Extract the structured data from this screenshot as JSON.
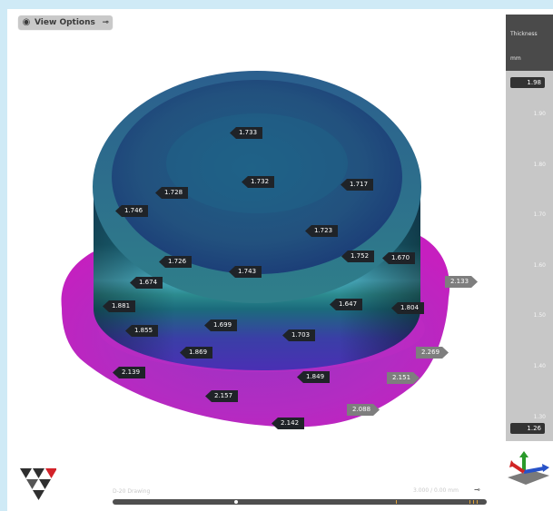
{
  "toolbar": {
    "view_options_label": "View Options"
  },
  "legend": {
    "title": "Thickness",
    "unit": "mm",
    "max_value": "1.98",
    "min_value": "1.26",
    "ticks": [
      "1.90",
      "1.80",
      "1.70",
      "1.60",
      "1.50",
      "1.40",
      "1.30"
    ],
    "colors": [
      "#e21ad7",
      "#9d2ad5",
      "#5a2fd3",
      "#3a6ee0",
      "#27b9bd",
      "#3ad24f",
      "#b8de1f",
      "#f4d414",
      "#f3841d",
      "#e11c23"
    ]
  },
  "measurements": [
    {
      "value": "1.733",
      "style": "dark"
    },
    {
      "value": "1.732",
      "style": "dark"
    },
    {
      "value": "1.728",
      "style": "dark"
    },
    {
      "value": "1.717",
      "style": "dark"
    },
    {
      "value": "1.746",
      "style": "dark"
    },
    {
      "value": "1.723",
      "style": "dark"
    },
    {
      "value": "1.752",
      "style": "dark"
    },
    {
      "value": "1.670",
      "style": "dark"
    },
    {
      "value": "1.726",
      "style": "dark"
    },
    {
      "value": "1.743",
      "style": "dark"
    },
    {
      "value": "1.674",
      "style": "dark"
    },
    {
      "value": "2.133",
      "style": "gray"
    },
    {
      "value": "1.647",
      "style": "dark"
    },
    {
      "value": "1.881",
      "style": "dark"
    },
    {
      "value": "1.804",
      "style": "dark"
    },
    {
      "value": "1.699",
      "style": "dark"
    },
    {
      "value": "1.855",
      "style": "dark"
    },
    {
      "value": "1.703",
      "style": "dark"
    },
    {
      "value": "1.869",
      "style": "dark"
    },
    {
      "value": "2.269",
      "style": "gray"
    },
    {
      "value": "2.139",
      "style": "dark"
    },
    {
      "value": "1.849",
      "style": "dark"
    },
    {
      "value": "2.151",
      "style": "gray"
    },
    {
      "value": "2.157",
      "style": "dark"
    },
    {
      "value": "2.088",
      "style": "gray"
    },
    {
      "value": "2.142",
      "style": "dark"
    }
  ],
  "footer": {
    "caption_left": "D-20 Drawing",
    "caption_right": "3.000 / 0.00 mm"
  }
}
